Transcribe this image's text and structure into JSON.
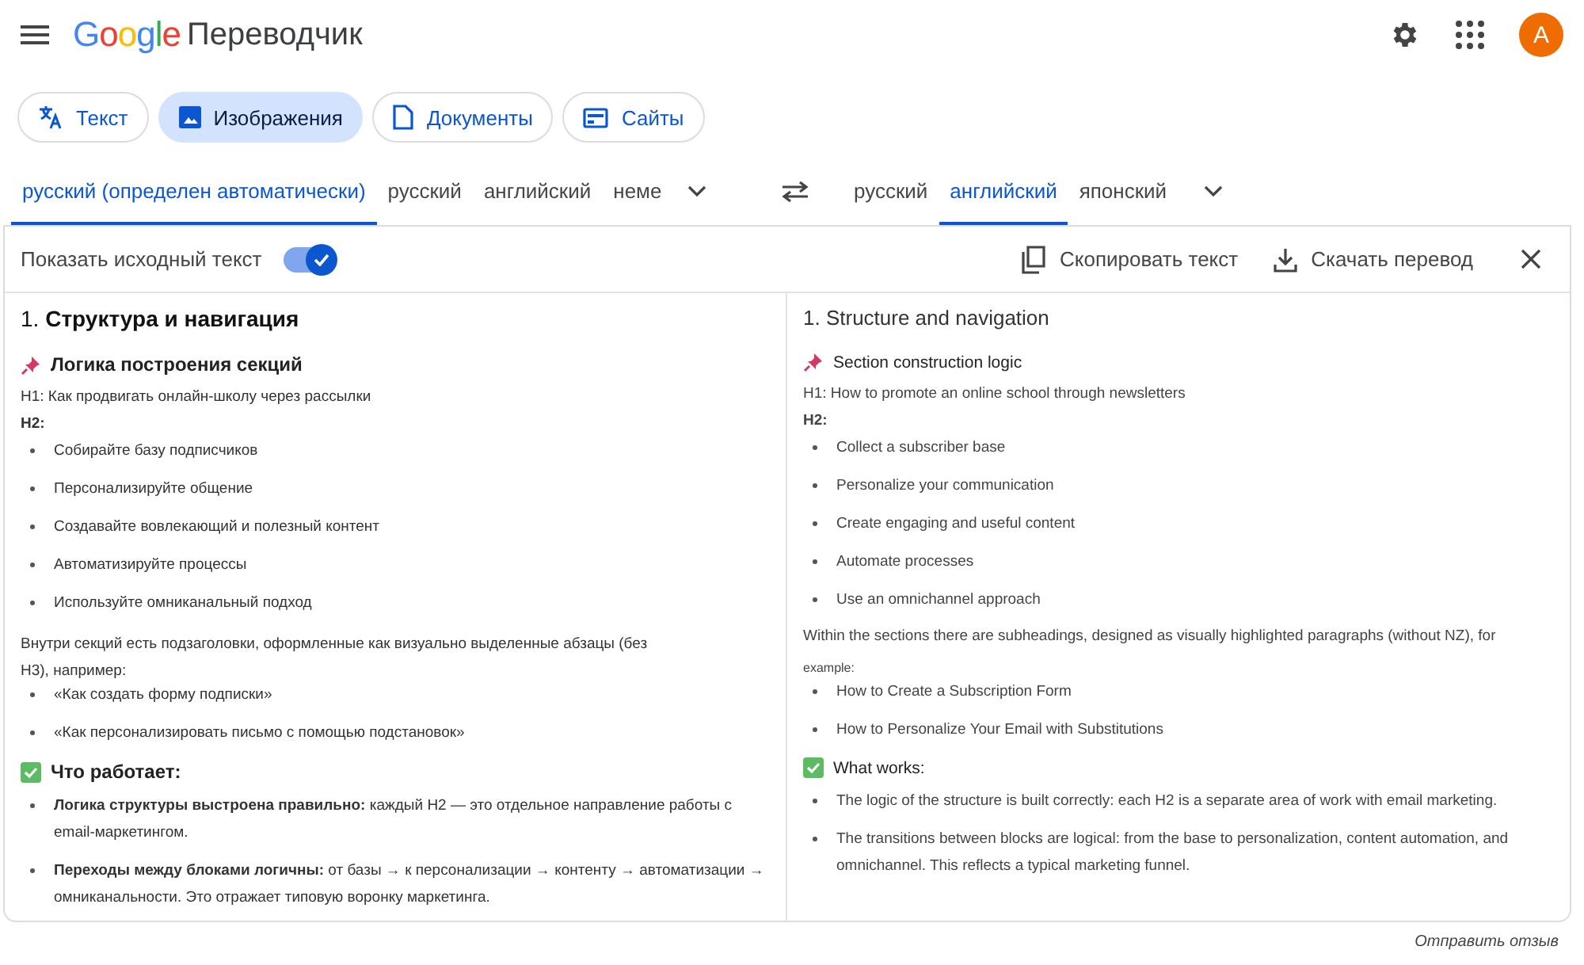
{
  "header": {
    "logo": "Google",
    "title": "Переводчик",
    "avatar": "A"
  },
  "modes": [
    {
      "label": "Текст",
      "selected": false
    },
    {
      "label": "Изображения",
      "selected": true
    },
    {
      "label": "Документы",
      "selected": false
    },
    {
      "label": "Сайты",
      "selected": false
    }
  ],
  "source_languages": [
    {
      "label": "русский (определен автоматически)",
      "selected": true
    },
    {
      "label": "русский",
      "selected": false
    },
    {
      "label": "английский",
      "selected": false
    },
    {
      "label": "неме",
      "selected": false
    }
  ],
  "target_languages": [
    {
      "label": "русский",
      "selected": false
    },
    {
      "label": "английский",
      "selected": true
    },
    {
      "label": "японский",
      "selected": false
    }
  ],
  "toolbar": {
    "toggle_label": "Показать исходный текст",
    "show_source": true,
    "copy": "Скопировать текст",
    "download": "Скачать перевод"
  },
  "source_document": [
    {
      "kind": "h1",
      "text": "1. **Структура и навигация**"
    },
    {
      "kind": "pin_heading",
      "text": "Логика построения секций"
    },
    {
      "kind": "line",
      "text": "H1: Как продвигать онлайн-школу через рассылки"
    },
    {
      "kind": "label",
      "text": "H2:"
    },
    {
      "kind": "bullet",
      "text": "Собирайте базу подписчиков"
    },
    {
      "kind": "bullet",
      "text": "Персонализируйте общение"
    },
    {
      "kind": "bullet",
      "text": "Создавайте вовлекающий и полезный контент"
    },
    {
      "kind": "bullet",
      "text": "Автоматизируйте процессы"
    },
    {
      "kind": "bullet",
      "text": "Используйте омниканальный подход"
    },
    {
      "kind": "para",
      "text": "Внутри секций есть подзаголовки, оформленные как визуально выделенные абзацы (без H3), например:"
    },
    {
      "kind": "bullet",
      "text": "«Как создать форму подписки»"
    },
    {
      "kind": "bullet",
      "text": "«Как персонализировать письмо с помощью подстановок»"
    },
    {
      "kind": "check_heading",
      "text": "Что работает:"
    },
    {
      "kind": "bullet",
      "text": "**Логика структуры выстроена правильно:** каждый H2 — это отдельное направление работы с email-маркетингом."
    },
    {
      "kind": "bullet",
      "text": "**Переходы между блоками логичны:** от базы → к персонализации → контенту → автоматизации → омниканальности. Это отражает типовую воронку маркетинга."
    }
  ],
  "translated_document": [
    {
      "kind": "h1",
      "text": "1. Structure and navigation"
    },
    {
      "kind": "pin_heading",
      "text": "Section construction logic"
    },
    {
      "kind": "line",
      "text": "H1: How to promote an online school through newsletters"
    },
    {
      "kind": "label",
      "text": "H2:"
    },
    {
      "kind": "bullet",
      "text": "Collect a subscriber base"
    },
    {
      "kind": "bullet",
      "text": "Personalize your communication"
    },
    {
      "kind": "bullet",
      "text": "Create engaging and useful content"
    },
    {
      "kind": "bullet",
      "text": "Automate processes"
    },
    {
      "kind": "bullet",
      "text": "Use an omnichannel approach"
    },
    {
      "kind": "line",
      "text": "Within the sections there are subheadings, designed as visually highlighted paragraphs (without NZ), for"
    },
    {
      "kind": "small",
      "text": "example:"
    },
    {
      "kind": "bullet",
      "text": "How to Create a Subscription Form"
    },
    {
      "kind": "bullet",
      "text": "How to Personalize Your Email with Substitutions"
    },
    {
      "kind": "check_heading",
      "text": "What works:"
    },
    {
      "kind": "bullet",
      "text": "The logic of the structure is built correctly: each H2 is a separate area of work with email marketing."
    },
    {
      "kind": "bullet",
      "text": "The transitions between blocks are logical: from the base to personalization, content automation, and omnichannel. This reflects a typical marketing funnel."
    }
  ],
  "feedback": "Отправить отзыв"
}
